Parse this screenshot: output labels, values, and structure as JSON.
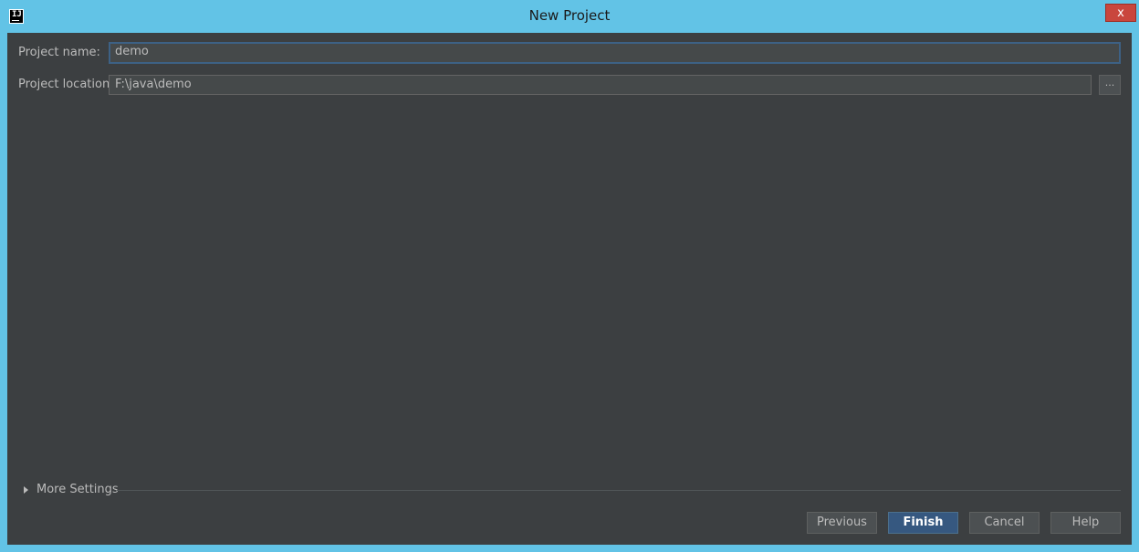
{
  "window": {
    "title": "New Project",
    "close_label": "x"
  },
  "form": {
    "project_name_label": "Project name:",
    "project_name_value": "demo",
    "project_location_label": "Project location:",
    "project_location_value": "F:\\java\\demo",
    "browse_label": "..."
  },
  "more_settings": {
    "label": "More Settings"
  },
  "buttons": {
    "previous": "Previous",
    "finish": "Finish",
    "cancel": "Cancel",
    "help": "Help"
  },
  "colors": {
    "titlebar": "#62c3e6",
    "dialog_bg": "#3c3f41",
    "primary_button": "#365880",
    "close_button": "#c9463d"
  }
}
